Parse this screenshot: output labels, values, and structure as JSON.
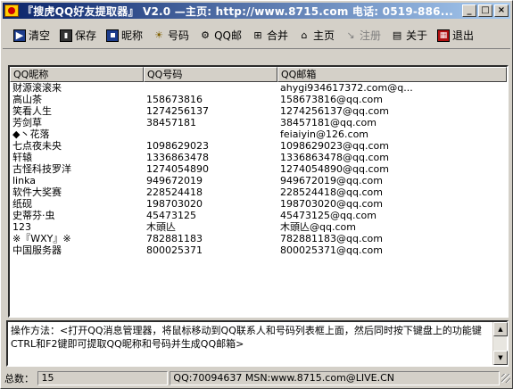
{
  "window": {
    "title": "『搜虎QQ好友提取器』 V2.0  —主页: http://www.8715.com 电话: 0519-886...",
    "minimize": "_",
    "maximize": "□",
    "close": "×"
  },
  "toolbar": {
    "clear": "清空",
    "save": "保存",
    "nickname": "昵称",
    "qqnumber": "号码",
    "qqmail": "QQ邮",
    "merge": "合并",
    "home": "主页",
    "register": "注册",
    "about": "关于",
    "exit": "退出"
  },
  "list": {
    "columns": [
      "QQ昵称",
      "QQ号码",
      "QQ邮箱"
    ],
    "rows": [
      [
        "财源滚滚来",
        "",
        "ahygi934617372.com@q..."
      ],
      [
        "高山茶",
        "158673816",
        "158673816@qq.com"
      ],
      [
        "笑看人生",
        "1274256137",
        "1274256137@qq.com"
      ],
      [
        "芳剑草",
        "38457181",
        "38457181@qq.com"
      ],
      [
        "◆丶花落",
        "",
        "feiaiyin@126.com"
      ],
      [
        "七点夜未央",
        "1098629023",
        "1098629023@qq.com"
      ],
      [
        "轩辕",
        "1336863478",
        "1336863478@qq.com"
      ],
      [
        "古怪科技罗洋",
        "1274054890",
        "1274054890@qq.com"
      ],
      [
        "linka",
        "949672019",
        "949672019@qq.com"
      ],
      [
        "软件大奖赛",
        "228524418",
        "228524418@qq.com"
      ],
      [
        "纸砚",
        "198703020",
        "198703020@qq.com"
      ],
      [
        "史蒂芬·虫",
        "45473125",
        "45473125@qq.com"
      ],
      [
        "123",
        "木頭亾",
        "木頭亾@qq.com"
      ],
      [
        "※『WXY』※",
        "782881183",
        "782881183@qq.com"
      ],
      [
        "中国服务器",
        "800025371",
        "800025371@qq.com"
      ]
    ]
  },
  "instructions": {
    "text": "操作方法：<打开QQ消息管理器，将鼠标移动到QQ联系人和号码列表框上面，然后同时按下键盘上的功能键CTRL和F2键即可提取QQ昵称和号码并生成QQ邮箱>"
  },
  "status": {
    "total_label": "总数：",
    "total_value": "15",
    "info": "QQ:70094637 MSN:www.8715.com@LIVE.CN"
  }
}
